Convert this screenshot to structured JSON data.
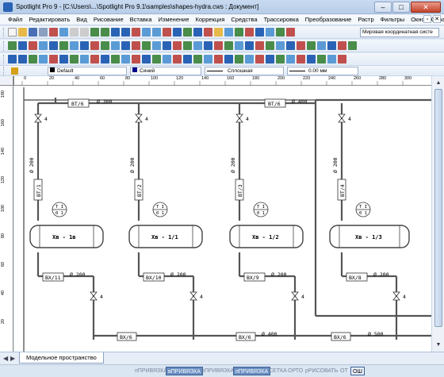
{
  "window": {
    "title": "Spotlight Pro 9 - [C:\\Users\\...\\Spotlight Pro 9.1\\samples\\shapes-hydra.cws : Документ]",
    "minimize": "–",
    "maximize": "□",
    "close": "✕"
  },
  "menu": {
    "items": [
      "Файл",
      "Редактировать",
      "Вид",
      "Рисование",
      "Вставка",
      "Изменение",
      "Коррекция",
      "Средства",
      "Трассировка",
      "Преобразование",
      "Растр",
      "Фильтры",
      "Окно",
      "Справка"
    ],
    "restore": "▫",
    "close": "✕"
  },
  "toolbar": {
    "coord_system": "Мировая координатная систе"
  },
  "properties": {
    "layer": "Default",
    "color": "Синий",
    "linetype": "Сплошная",
    "lineweight": "0.00 мм"
  },
  "rulers": {
    "h_labels": [
      "0",
      "20",
      "40",
      "60",
      "80",
      "100",
      "120",
      "140",
      "160",
      "180",
      "200",
      "220",
      "240",
      "260",
      "280",
      "300"
    ],
    "v_labels": [
      "180",
      "160",
      "140",
      "120",
      "100",
      "80",
      "60",
      "40",
      "20"
    ]
  },
  "drawing": {
    "exchangers": [
      "Хв - 1в",
      "Хв - 1/1",
      "Хв - 1/2",
      "Хв - 1/3"
    ],
    "gauges_top": [
      "ВТ/6",
      "ВТ/6"
    ],
    "diam_top": [
      "Ø 300",
      "Ø 400"
    ],
    "vert_labels": [
      "ВТ/1",
      "ВТ/2",
      "ВТ/3",
      "ВТ/4"
    ],
    "vert_diams": [
      "Ø 200",
      "Ø 200",
      "Ø 200",
      "Ø 200"
    ],
    "ti_labels": [
      "T I",
      "T I",
      "T I",
      "T I"
    ],
    "ti_sub": [
      "0 1",
      "0 1",
      "0 1",
      "0 1"
    ],
    "bottom_tags": [
      "ВХ/11",
      "ВХ/10",
      "ВХ/9",
      "ВХ/8"
    ],
    "bottom_diams": [
      "Ø 200",
      "Ø 200",
      "Ø 200",
      "Ø 200"
    ],
    "lowest_tags": [
      "ВХ/6",
      "ВХ/6",
      "ВХ/6"
    ],
    "lowest_diams": [
      "Ø 400",
      "Ø 500"
    ],
    "valve_num": "4"
  },
  "tabs": {
    "model": "Модельное пространство"
  },
  "status": {
    "items": [
      "пПРИВЯЗКА",
      "вПРИВЯЗКА",
      "оПРИВЯЗКА",
      "пПРИВЯЗКА",
      "СЕТКА",
      "ОРТО",
      "рРИСОВАТЬ",
      "ОТ",
      "ОШ"
    ]
  }
}
